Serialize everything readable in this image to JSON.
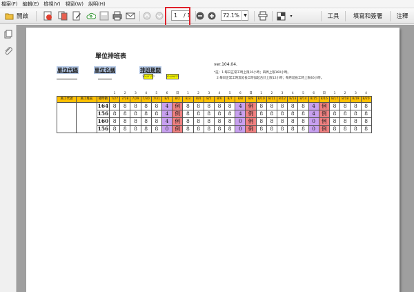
{
  "menu": [
    "檔案(F)",
    "編輯(E)",
    "檢視(V)",
    "視窗(W)",
    "說明(H)"
  ],
  "toolbar": {
    "open_label": "開啟",
    "page_current": "1",
    "page_total": "/ 1",
    "zoom": "72.1%",
    "tools_label": "工具",
    "fill_sign_label": "填寫和簽署",
    "comment_label": "注釋"
  },
  "doc": {
    "title": "單位排班表",
    "unit_code_label": "單位代碼",
    "unit_name_label": "單位名稱",
    "period_label": "排班期間",
    "period_start": "104/07/27",
    "period_end": "104/08/23",
    "version": "ver.104.04.",
    "note1": "*註：1.每日正常工時上限10小時；四周上限160小時。",
    "note2": "2.每日正常工時及延長工時加起合計上限12小時；每月延長工時上限46小時。",
    "header_emp_id": "員工代號",
    "header_emp_name": "員工姓名",
    "header_total": "總時數",
    "weekday_nums": [
      "1",
      "2",
      "3",
      "4",
      "5",
      "6",
      "日",
      "1",
      "2",
      "3",
      "4",
      "5",
      "6",
      "日",
      "1",
      "2",
      "3",
      "4",
      "5",
      "6",
      "日",
      "1",
      "2",
      "3",
      "4"
    ],
    "dates": [
      "7/27",
      "7/28",
      "7/29",
      "7/30",
      "7/31",
      "8/1",
      "8/2",
      "8/3",
      "8/4",
      "8/5",
      "8/6",
      "8/7",
      "8/8",
      "8/9",
      "8/10",
      "8/11",
      "8/12",
      "8/13",
      "8/14",
      "8/15",
      "8/16",
      "8/17",
      "8/18",
      "8/19",
      "8/20"
    ],
    "rows": [
      {
        "total": "164",
        "cells": [
          "8",
          "8",
          "8",
          "8",
          "8",
          "4",
          "例",
          "8",
          "8",
          "8",
          "8",
          "8",
          "4",
          "例",
          "8",
          "8",
          "8",
          "8",
          "8",
          "4",
          "例",
          "8",
          "8",
          "8",
          "8"
        ]
      },
      {
        "total": "156",
        "cells": [
          "8",
          "8",
          "8",
          "8",
          "8",
          "4",
          "例",
          "8",
          "8",
          "8",
          "8",
          "8",
          "4",
          "例",
          "8",
          "8",
          "8",
          "8",
          "8",
          "4",
          "例",
          "8",
          "8",
          "8",
          "8"
        ]
      },
      {
        "total": "160",
        "cells": [
          "8",
          "8",
          "8",
          "8",
          "8",
          "4",
          "例",
          "8",
          "8",
          "8",
          "8",
          "8",
          "0",
          "例",
          "8",
          "8",
          "8",
          "8",
          "8",
          "0",
          "例",
          "8",
          "8",
          "8",
          "8"
        ]
      },
      {
        "total": "156",
        "cells": [
          "8",
          "8",
          "8",
          "8",
          "8",
          "0",
          "例",
          "8",
          "8",
          "8",
          "8",
          "8",
          "0",
          "例",
          "8",
          "8",
          "8",
          "8",
          "8",
          "0",
          "例",
          "8",
          "8",
          "8",
          "8"
        ]
      }
    ]
  },
  "colors": {
    "saturday": "#c8a0f0",
    "sunday": "#f08080",
    "header": "#ffc000",
    "highlight": "#e0202a"
  }
}
